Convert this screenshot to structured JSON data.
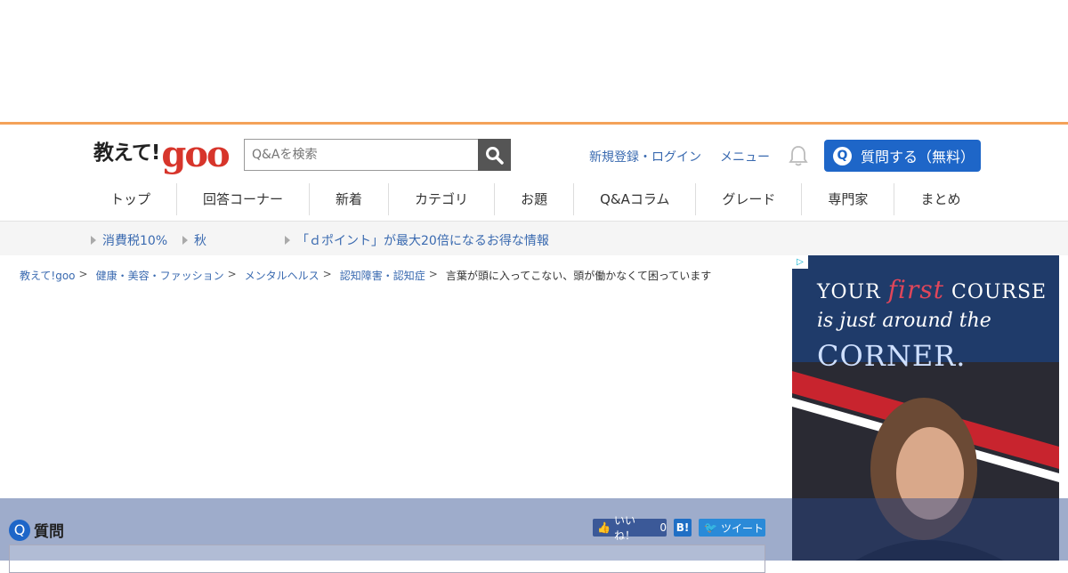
{
  "header": {
    "logo_jp": "教えて!",
    "logo_goo": "goo",
    "search_placeholder": "Q&Aを検索",
    "register_login": "新規登録・ログイン",
    "menu": "メニュー",
    "ask_button": "質問する（無料）",
    "ask_q": "Q"
  },
  "nav": {
    "items": [
      "トップ",
      "回答コーナー",
      "新着",
      "カテゴリ",
      "お題",
      "Q&Aコラム",
      "グレード",
      "専門家",
      "まとめ"
    ]
  },
  "notices": [
    "消費税10%",
    "秋",
    "「ｄポイント」が最大20倍になるお得な情報"
  ],
  "breadcrumb": [
    "教えて!goo",
    "健康・美容・ファッション",
    "メンタルヘルス",
    "認知障害・認知症",
    "言葉が頭に入ってこない、頭が働かなくて困っています"
  ],
  "ad": {
    "line1_a": "YOUR ",
    "line1_b": "first",
    "line1_c": " COURSE",
    "line2": "is just around the",
    "line3": "CORNER."
  },
  "question": {
    "label": "質問",
    "q": "Q",
    "like_label": "いいね！",
    "like_count": "0",
    "hatena": "B!",
    "tweet": "ツイート"
  },
  "colors": {
    "accent_blue": "#1e66c8",
    "logo_red": "#d7352b",
    "link_blue": "#3a6ab0",
    "orange_line": "#f4a259"
  }
}
